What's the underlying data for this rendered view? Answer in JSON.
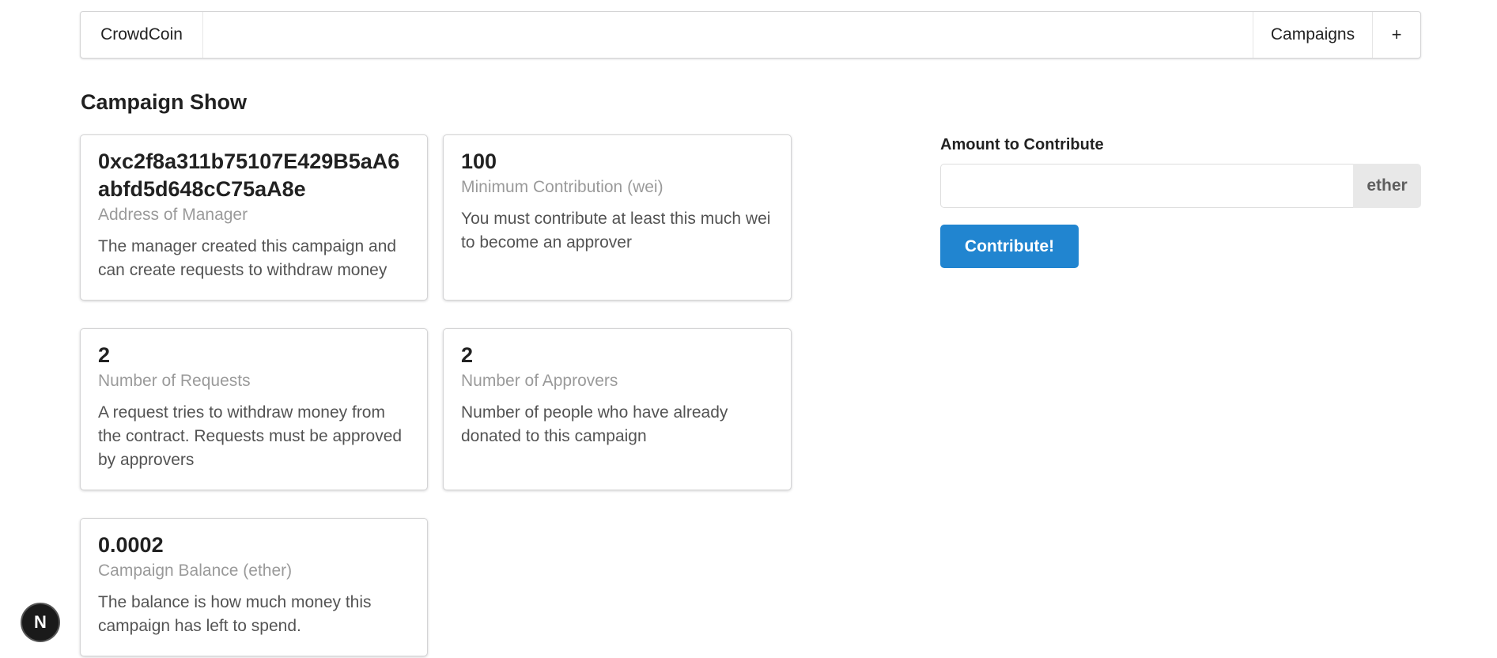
{
  "nav": {
    "brand": "CrowdCoin",
    "campaigns": "Campaigns",
    "add": "+"
  },
  "page": {
    "title": "Campaign Show"
  },
  "cards": [
    {
      "header": "0xc2f8a311b75107E429B5aA6abfd5d648cC75aA8e",
      "meta": "Address of Manager",
      "description": "The manager created this campaign and can create requests to withdraw money"
    },
    {
      "header": "100",
      "meta": "Minimum Contribution (wei)",
      "description": "You must contribute at least this much wei to become an approver"
    },
    {
      "header": "2",
      "meta": "Number of Requests",
      "description": "A request tries to withdraw money from the contract. Requests must be approved by approvers"
    },
    {
      "header": "2",
      "meta": "Number of Approvers",
      "description": "Number of people who have already donated to this campaign"
    },
    {
      "header": "0.0002",
      "meta": "Campaign Balance (ether)",
      "description": "The balance is how much money this campaign has left to spend."
    }
  ],
  "contribute_form": {
    "label": "Amount to Contribute",
    "value": "",
    "placeholder": "",
    "unit": "ether",
    "button": "Contribute!"
  },
  "dev_badge": {
    "letter": "N"
  },
  "colors": {
    "primary": "#2185d0",
    "badge_bg": "#1a1a1a"
  }
}
